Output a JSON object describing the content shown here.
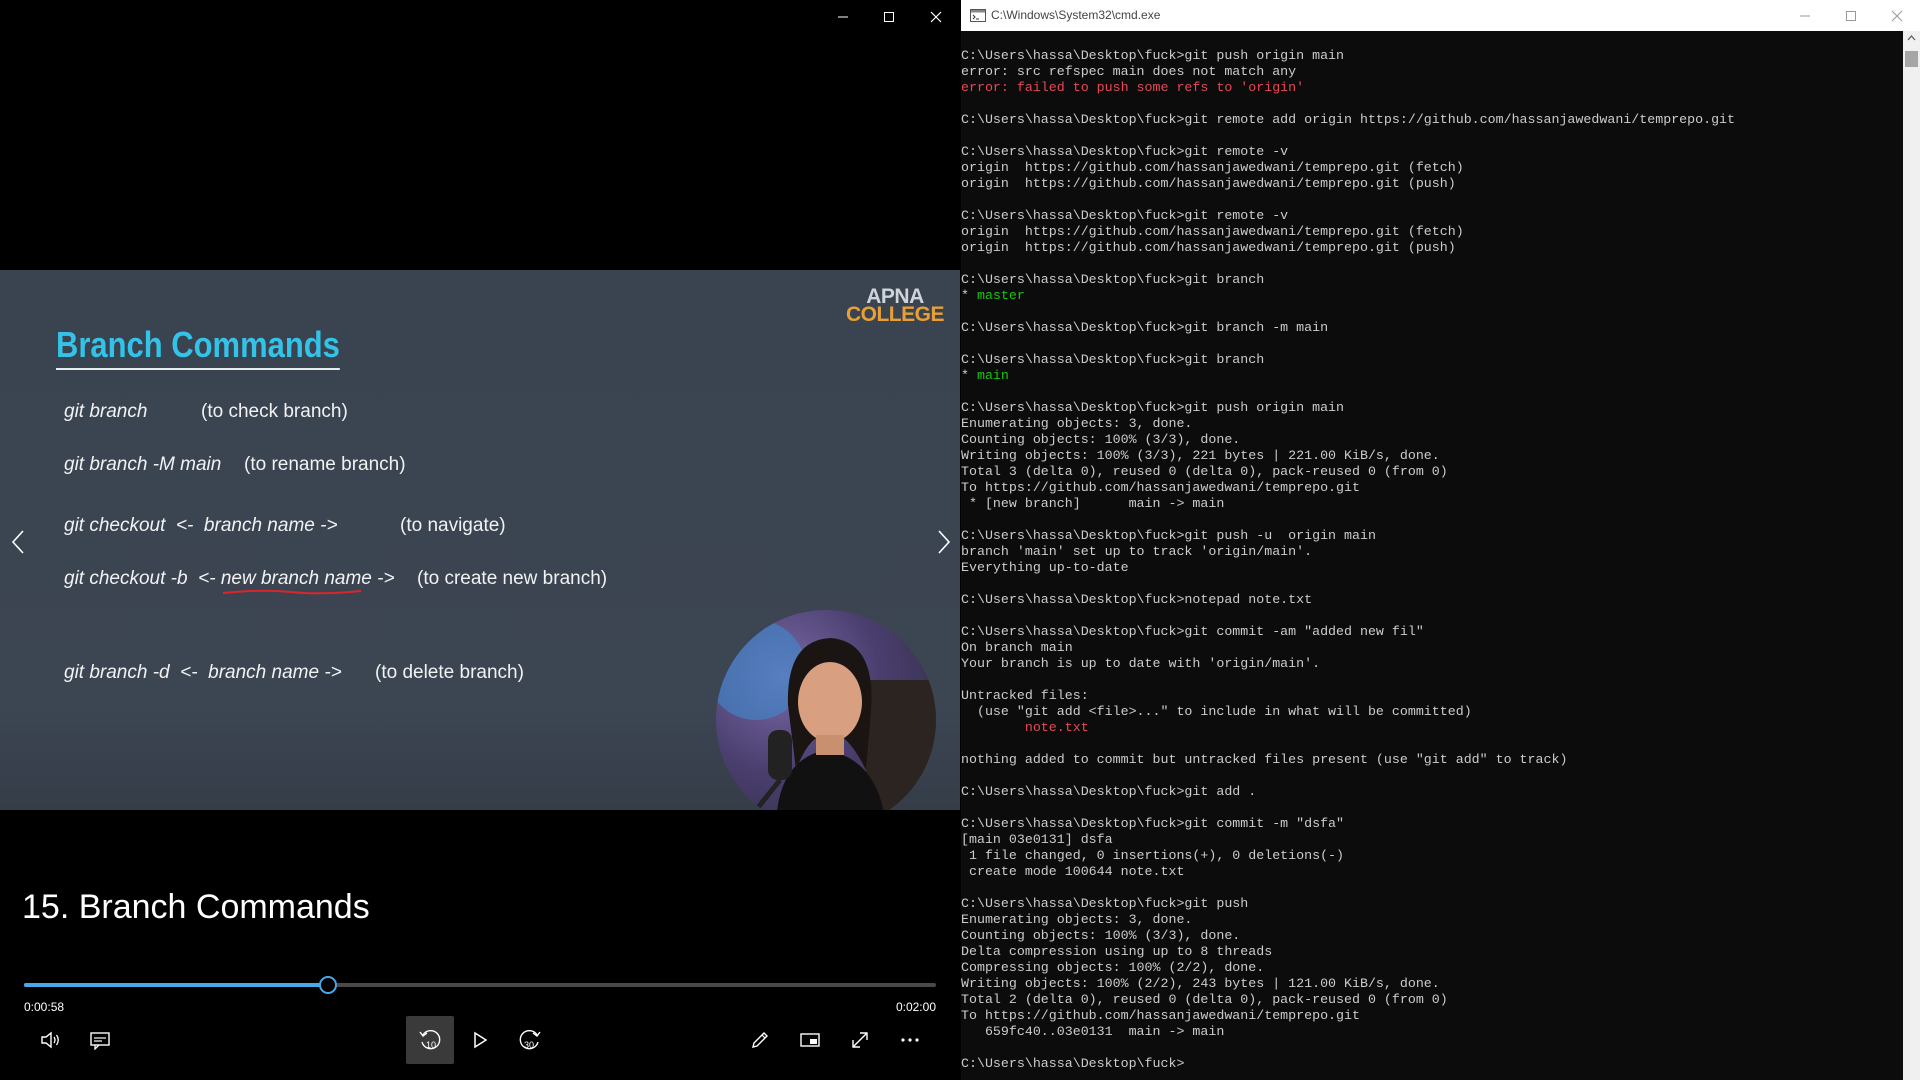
{
  "player": {
    "video_title": "15. Branch Commands",
    "time_current": "0:00:58",
    "time_total": "0:02:00",
    "progress_fraction": 0.333,
    "slide": {
      "logo_line1": "APNA",
      "logo_line2": "COLLEGE",
      "title": "Branch Commands",
      "rows": [
        {
          "cmd": "git branch",
          "desc": "(to check branch)"
        },
        {
          "cmd": "git branch -M main",
          "desc": "(to rename branch)"
        },
        {
          "cmd": "git checkout  <-  branch name ->",
          "desc": "(to navigate)"
        },
        {
          "cmd_pre": "git checkout -b  <- ",
          "cmd_ul": "new branch name",
          "cmd_post": " ->",
          "desc": "(to create new branch)"
        },
        {
          "cmd": "git branch -d  <-  branch name ->",
          "desc": "(to delete branch)"
        }
      ]
    },
    "controls": {
      "skip_back_label": "10",
      "skip_forward_label": "30"
    }
  },
  "terminal": {
    "title": "C:\\Windows\\System32\\cmd.exe",
    "lines": [
      {
        "t": "C:\\Users\\hassa\\Desktop\\fuck>git push origin main"
      },
      {
        "t": "error: src refspec main does not match any"
      },
      {
        "t": "error: failed to push some refs to 'origin'",
        "c": "red"
      },
      {
        "t": ""
      },
      {
        "t": "C:\\Users\\hassa\\Desktop\\fuck>git remote add origin https://github.com/hassanjawedwani/temprepo.git"
      },
      {
        "t": ""
      },
      {
        "t": "C:\\Users\\hassa\\Desktop\\fuck>git remote -v"
      },
      {
        "t": "origin  https://github.com/hassanjawedwani/temprepo.git (fetch)"
      },
      {
        "t": "origin  https://github.com/hassanjawedwani/temprepo.git (push)"
      },
      {
        "t": ""
      },
      {
        "t": "C:\\Users\\hassa\\Desktop\\fuck>git remote -v"
      },
      {
        "t": "origin  https://github.com/hassanjawedwani/temprepo.git (fetch)"
      },
      {
        "t": "origin  https://github.com/hassanjawedwani/temprepo.git (push)"
      },
      {
        "t": ""
      },
      {
        "t": "C:\\Users\\hassa\\Desktop\\fuck>git branch"
      },
      {
        "t": "* ",
        "g": "master"
      },
      {
        "t": ""
      },
      {
        "t": "C:\\Users\\hassa\\Desktop\\fuck>git branch -m main"
      },
      {
        "t": ""
      },
      {
        "t": "C:\\Users\\hassa\\Desktop\\fuck>git branch"
      },
      {
        "t": "* ",
        "g": "main"
      },
      {
        "t": ""
      },
      {
        "t": "C:\\Users\\hassa\\Desktop\\fuck>git push origin main"
      },
      {
        "t": "Enumerating objects: 3, done."
      },
      {
        "t": "Counting objects: 100% (3/3), done."
      },
      {
        "t": "Writing objects: 100% (3/3), 221 bytes | 221.00 KiB/s, done."
      },
      {
        "t": "Total 3 (delta 0), reused 0 (delta 0), pack-reused 0 (from 0)"
      },
      {
        "t": "To https://github.com/hassanjawedwani/temprepo.git"
      },
      {
        "t": " * [new branch]      main -> main"
      },
      {
        "t": ""
      },
      {
        "t": "C:\\Users\\hassa\\Desktop\\fuck>git push -u  origin main"
      },
      {
        "t": "branch 'main' set up to track 'origin/main'."
      },
      {
        "t": "Everything up-to-date"
      },
      {
        "t": ""
      },
      {
        "t": "C:\\Users\\hassa\\Desktop\\fuck>notepad note.txt"
      },
      {
        "t": ""
      },
      {
        "t": "C:\\Users\\hassa\\Desktop\\fuck>git commit -am \"added new fil\""
      },
      {
        "t": "On branch main"
      },
      {
        "t": "Your branch is up to date with 'origin/main'."
      },
      {
        "t": ""
      },
      {
        "t": "Untracked files:"
      },
      {
        "t": "  (use \"git add <file>...\" to include in what will be committed)"
      },
      {
        "t": "        note.txt",
        "c": "red"
      },
      {
        "t": ""
      },
      {
        "t": "nothing added to commit but untracked files present (use \"git add\" to track)"
      },
      {
        "t": ""
      },
      {
        "t": "C:\\Users\\hassa\\Desktop\\fuck>git add ."
      },
      {
        "t": ""
      },
      {
        "t": "C:\\Users\\hassa\\Desktop\\fuck>git commit -m \"dsfa\""
      },
      {
        "t": "[main 03e0131] dsfa"
      },
      {
        "t": " 1 file changed, 0 insertions(+), 0 deletions(-)"
      },
      {
        "t": " create mode 100644 note.txt"
      },
      {
        "t": ""
      },
      {
        "t": "C:\\Users\\hassa\\Desktop\\fuck>git push"
      },
      {
        "t": "Enumerating objects: 3, done."
      },
      {
        "t": "Counting objects: 100% (3/3), done."
      },
      {
        "t": "Delta compression using up to 8 threads"
      },
      {
        "t": "Compressing objects: 100% (2/2), done."
      },
      {
        "t": "Writing objects: 100% (2/2), 243 bytes | 121.00 KiB/s, done."
      },
      {
        "t": "Total 2 (delta 0), reused 0 (delta 0), pack-reused 0 (from 0)"
      },
      {
        "t": "To https://github.com/hassanjawedwani/temprepo.git"
      },
      {
        "t": "   659fc40..03e0131  main -> main"
      },
      {
        "t": ""
      },
      {
        "t": "C:\\Users\\hassa\\Desktop\\fuck>"
      }
    ]
  },
  "colors": {
    "accent": "#4aa7e8",
    "slide_title": "#33c3e8",
    "logo_orange": "#e8a036",
    "error_red": "#e74856",
    "branch_green": "#16c60c"
  },
  "icons": {
    "player": [
      "minimize-icon",
      "maximize-icon",
      "close-icon",
      "prev-arrow-icon",
      "next-arrow-icon",
      "volume-icon",
      "subtitles-icon",
      "skip-back-10-icon",
      "play-icon",
      "skip-forward-30-icon",
      "pen-icon",
      "mini-view-icon",
      "fullscreen-icon",
      "more-icon"
    ],
    "terminal": [
      "cmd-app-icon",
      "minimize-icon",
      "maximize-icon",
      "close-icon"
    ]
  }
}
